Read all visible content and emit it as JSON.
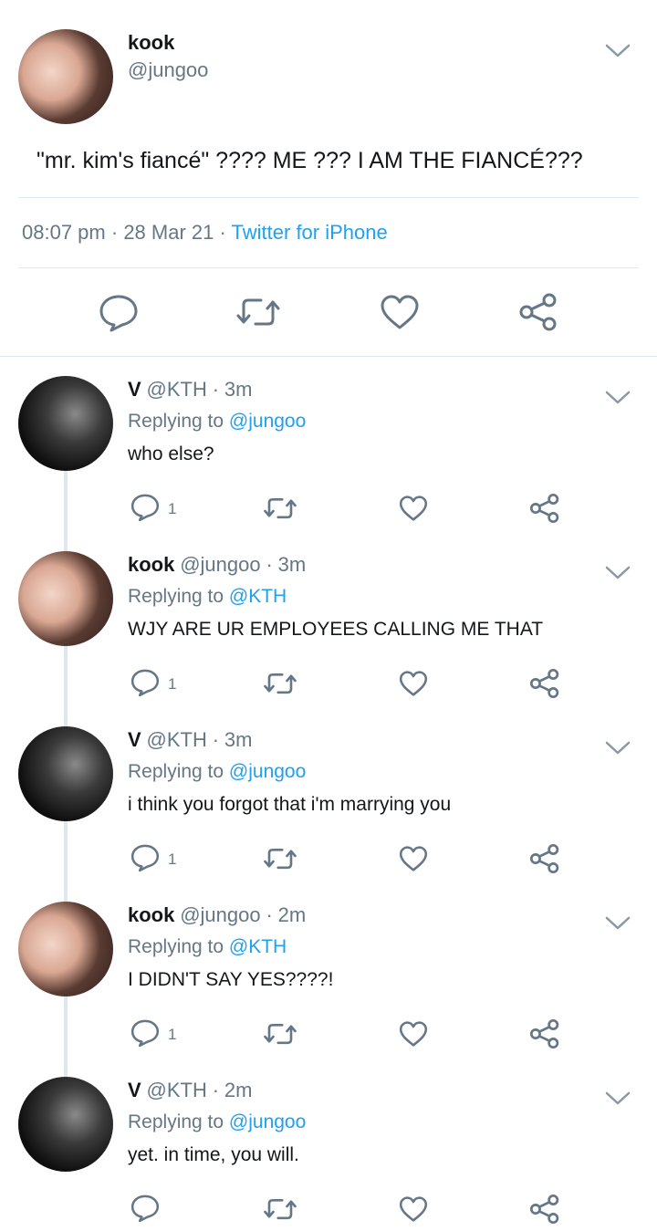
{
  "main_tweet": {
    "name": "kook",
    "handle": "@jungoo",
    "text": "\"mr. kim's fiancé\" ???? ME ??? I AM THE FIANCÉ???",
    "time": "08:07 pm",
    "dot1": "·",
    "date": "28 Mar 21",
    "dot2": "·",
    "source": "Twitter for iPhone"
  },
  "replies": [
    {
      "name": "V",
      "handle": "@KTH",
      "dot": "·",
      "time": "3m",
      "replying_prefix": "Replying to",
      "replying_to": "@jungoo",
      "text": "who else?",
      "reply_count": "1"
    },
    {
      "name": "kook",
      "handle": "@jungoo",
      "dot": "·",
      "time": "3m",
      "replying_prefix": "Replying to",
      "replying_to": "@KTH",
      "text": "WJY ARE UR EMPLOYEES CALLING ME THAT",
      "reply_count": "1"
    },
    {
      "name": "V",
      "handle": "@KTH",
      "dot": "·",
      "time": "3m",
      "replying_prefix": "Replying to",
      "replying_to": "@jungoo",
      "text": "i think you forgot that i'm marrying you",
      "reply_count": "1"
    },
    {
      "name": "kook",
      "handle": "@jungoo",
      "dot": "·",
      "time": "2m",
      "replying_prefix": "Replying to",
      "replying_to": "@KTH",
      "text": "I DIDN'T SAY YES????!",
      "reply_count": "1"
    },
    {
      "name": "V",
      "handle": "@KTH",
      "dot": "·",
      "time": "2m",
      "replying_prefix": "Replying to",
      "replying_to": "@jungoo",
      "text": "yet. in time, you will.",
      "reply_count": ""
    }
  ],
  "colors": {
    "accent": "#1da1f2",
    "secondary_text": "#657786",
    "icon": "#657786",
    "divider": "#e1e8ed"
  },
  "icons": [
    "reply-icon",
    "retweet-icon",
    "like-icon",
    "share-icon",
    "chevron-down-icon"
  ]
}
